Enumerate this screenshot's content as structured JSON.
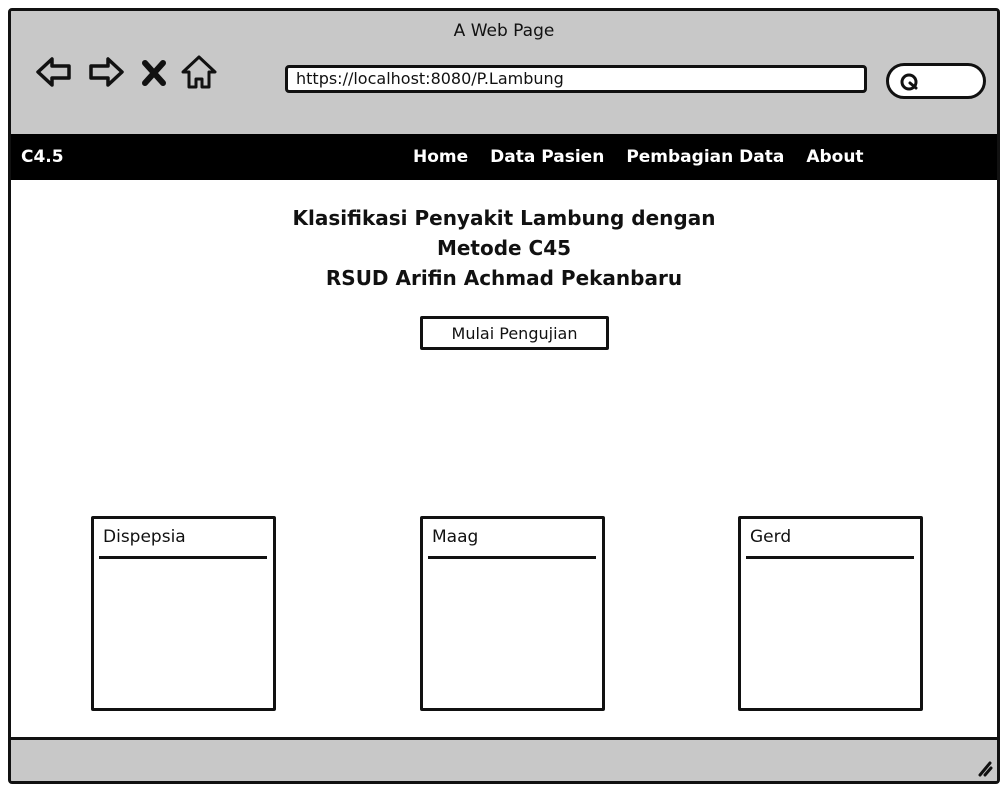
{
  "window": {
    "title": "A Web Page"
  },
  "toolbar": {
    "url": "https://localhost:8080/P.Lambung",
    "icons": [
      "back-arrow-icon",
      "forward-arrow-icon",
      "close-icon",
      "home-icon",
      "search-icon"
    ]
  },
  "navbar": {
    "brand": "C4.5",
    "links": [
      "Home",
      "Data Pasien",
      "Pembagian Data",
      "About"
    ]
  },
  "main": {
    "title_lines": [
      "Klasifikasi Penyakit Lambung dengan",
      "Metode C45",
      "RSUD Arifin Achmad Pekanbaru"
    ],
    "start_button_label": "Mulai Pengujian",
    "cards": [
      "Dispepsia",
      "Maag",
      "Gerd"
    ]
  },
  "colors": {
    "chrome_gray": "#c8c8c8",
    "navbar_black": "#000000",
    "ink": "#111111"
  }
}
